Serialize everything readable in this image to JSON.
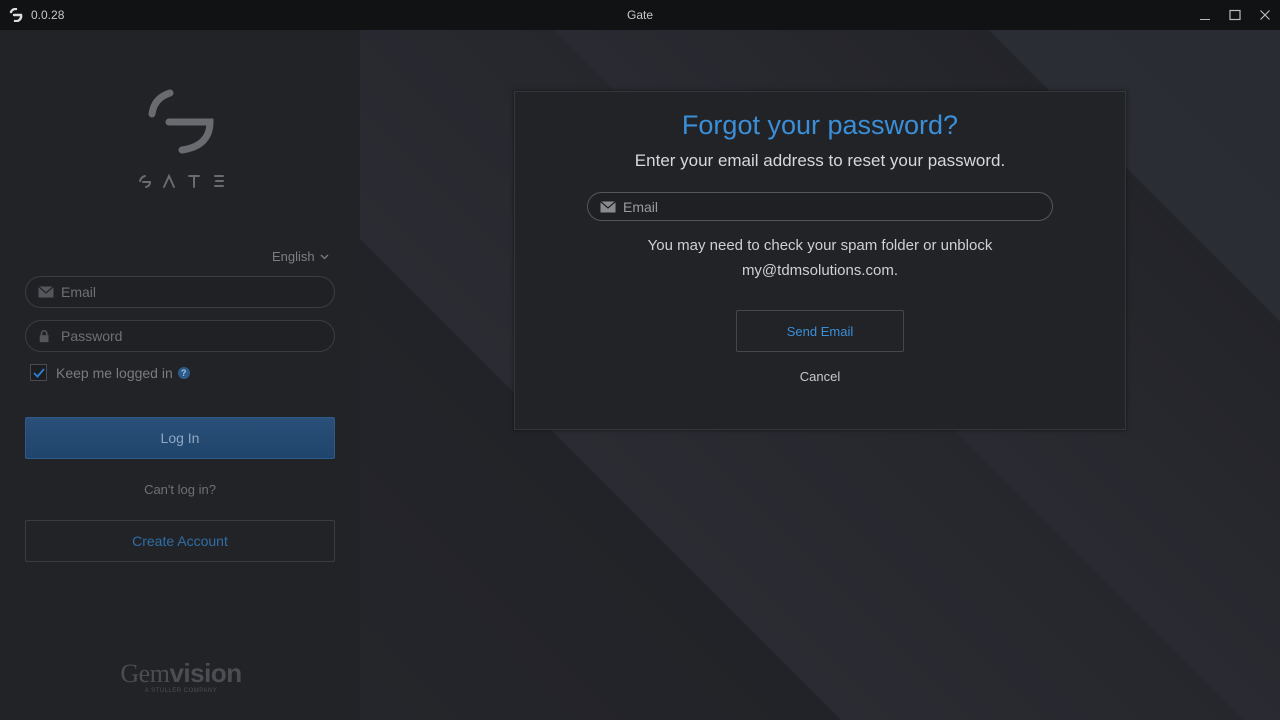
{
  "titlebar": {
    "version": "0.0.28",
    "title": "Gate",
    "icons": [
      "app-logo-icon",
      "minimize-icon",
      "maximize-icon",
      "close-icon"
    ]
  },
  "left_panel": {
    "language": "English",
    "email_placeholder": "Email",
    "password_placeholder": "Password",
    "keep_logged_in": "Keep me logged in",
    "keep_logged_in_checked": true,
    "help_glyph": "?",
    "login_button": "Log In",
    "cant_login": "Can't log in?",
    "create_account": "Create Account",
    "footer_brand_light": "Gem",
    "footer_brand_bold": "vision",
    "footer_tagline": "A STULLER COMPANY"
  },
  "dialog": {
    "title": "Forgot your password?",
    "subtitle": "Enter your email address to reset your password.",
    "email_placeholder": "Email",
    "note_line1": "You may need to check your spam folder or unblock",
    "note_line2": "my@tdmsolutions.com.",
    "send_button": "Send Email",
    "cancel": "Cancel"
  },
  "colors": {
    "accent": "#3a8fd8",
    "login_button": "#24496f",
    "panel": "#222327",
    "titlebar": "#111214"
  }
}
